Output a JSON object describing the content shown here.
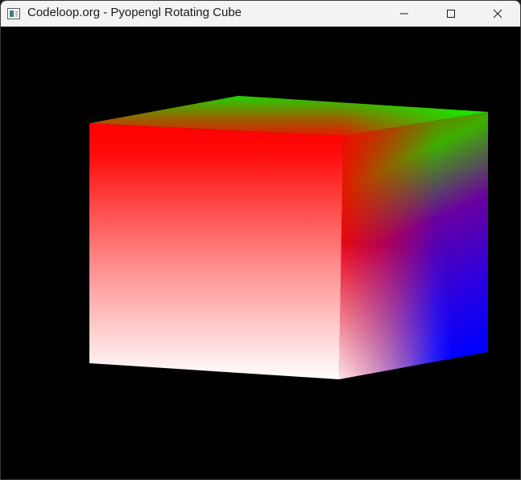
{
  "window": {
    "title": "Codeloop.org - Pyopengl Rotating Cube",
    "icon": "app-window-icon",
    "controls": {
      "minimize": "minimize-icon",
      "maximize": "maximize-icon",
      "close": "close-icon"
    }
  },
  "scene": {
    "background": "#000000",
    "faces": {
      "front": {
        "top_color": "#ff0000",
        "bottom_color": "#ffffff"
      },
      "top": {
        "back_color": "#00ff00",
        "front_color": "#ff0000"
      },
      "side": {
        "top_color": "#00ff00",
        "middle_color": "#6b00a0",
        "bottom_color": "#0000ff",
        "fade_color": "#ffffff"
      }
    }
  }
}
